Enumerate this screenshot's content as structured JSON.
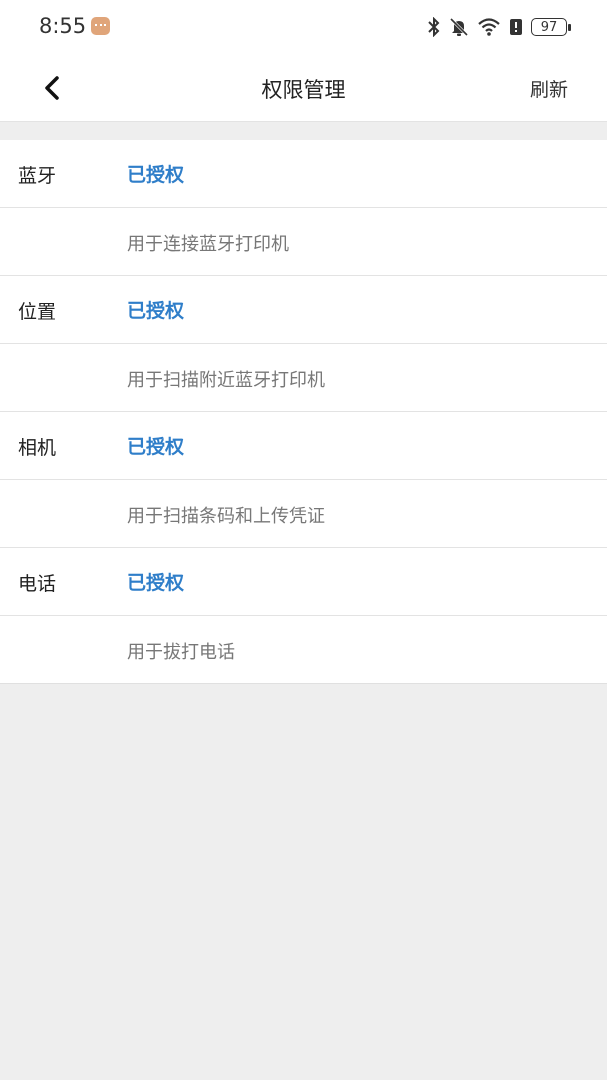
{
  "status_bar": {
    "time": "8:55",
    "battery": "97",
    "icons": [
      "message-icon",
      "bluetooth-icon",
      "mute-bell-icon",
      "wifi-icon",
      "alert-icon",
      "battery-icon"
    ]
  },
  "header": {
    "title": "权限管理",
    "refresh_label": "刷新",
    "back_icon": "chevron-left-icon"
  },
  "permissions": [
    {
      "name": "蓝牙",
      "status": "已授权",
      "description": "用于连接蓝牙打印机"
    },
    {
      "name": "位置",
      "status": "已授权",
      "description": "用于扫描附近蓝牙打印机"
    },
    {
      "name": "相机",
      "status": "已授权",
      "description": "用于扫描条码和上传凭证"
    },
    {
      "name": "电话",
      "status": "已授权",
      "description": "用于拔打电话"
    }
  ],
  "colors": {
    "granted": "#2f7ec9",
    "background": "#eeeeee",
    "card": "#ffffff"
  }
}
